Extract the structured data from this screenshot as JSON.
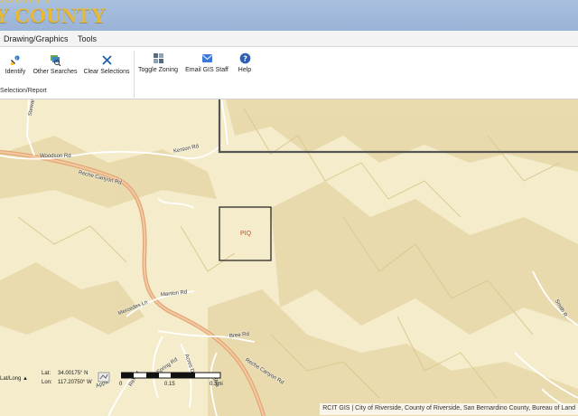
{
  "header": {
    "line1": "COUNTY",
    "line2": "Y COUNTY",
    "text_color": "#e8b933",
    "background": "#a9c0de"
  },
  "menubar": {
    "items": [
      "Drawing/Graphics",
      "Tools"
    ]
  },
  "ribbon": {
    "tools": [
      {
        "label": "Identify",
        "icon": "identify-icon"
      },
      {
        "label": "Other Searches",
        "icon": "other-searches-icon"
      },
      {
        "label": "Clear Selections",
        "icon": "clear-x-icon"
      },
      {
        "label": "Toggle Zoning",
        "icon": "grid-icon"
      },
      {
        "label": "Email GIS Staff",
        "icon": "mail-icon"
      },
      {
        "label": "Help",
        "icon": "help-icon"
      }
    ],
    "group_label": "Selection/Report"
  },
  "map": {
    "background": "#f4ecca",
    "road_labels": {
      "stewart": "Stewar",
      "woodson": "Woodson Rd",
      "kerson": "Kerson Rd",
      "reche_canyon_1": "Reche Canyon Rd",
      "manton": "Manton Rd",
      "mercedes": "Mercedes Ln",
      "bree": "Bree Rd",
      "spring": "Spring Rd",
      "acres": "Acres Dr",
      "rex": "Rex Ct",
      "reche_canyon_2": "Reche Canyon Rd",
      "apple": "Apple",
      "agua": "Agua",
      "smith": "Smith R"
    },
    "piq_label": "PIQ",
    "piq_color": "#d9472b",
    "boundary_color": "#555555"
  },
  "coords": {
    "toggle_label": "Lat/Long ▲",
    "lat_label": "Lat:",
    "lat_value": "34.00175° N",
    "lon_label": "Lon:",
    "lon_value": "117.20750° W"
  },
  "scale": {
    "ticks": [
      "0",
      "0.15",
      "0.3mi"
    ]
  },
  "attribution": "RCIT GIS | City of Riverside, County of Riverside, San Bernardino County, Bureau of Land"
}
